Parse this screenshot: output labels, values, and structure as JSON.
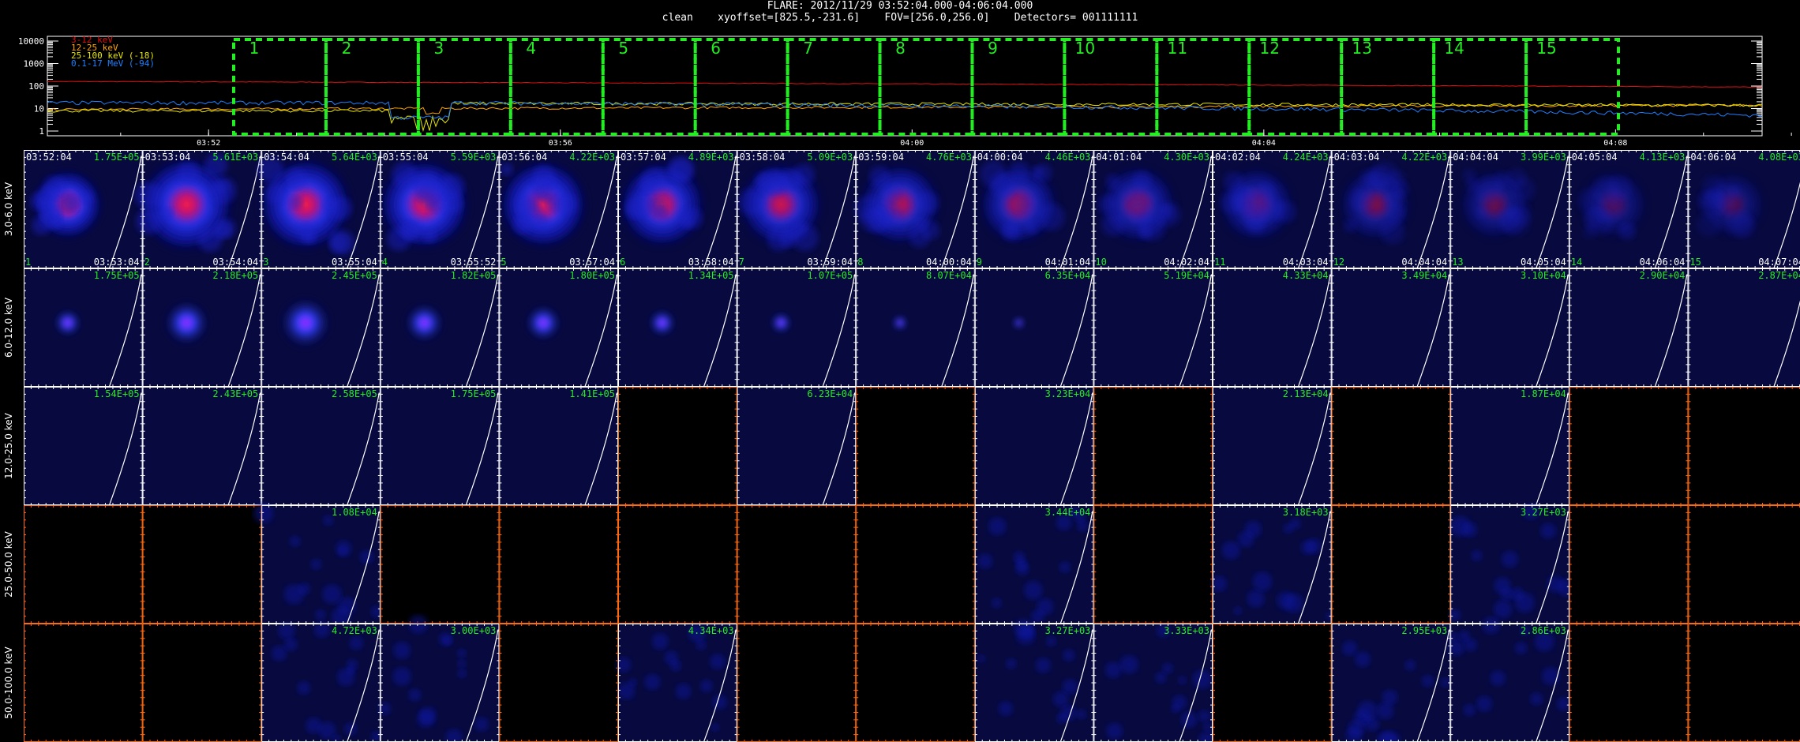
{
  "header": {
    "title": "FLARE: 2012/11/29 03:52:04.000-04:06:04.000",
    "subtitle": "clean    xyoffset=[825.5,-231.6]    FOV=[256.0,256.0]    Detectors= 001111111"
  },
  "lightcurve": {
    "legend": [
      {
        "label": "3-12 keV",
        "color": "#e01010"
      },
      {
        "label": "12-25 keV",
        "color": "#ffa500"
      },
      {
        "label": "25-100 keV (-18)",
        "color": "#e6e600"
      },
      {
        "label": "0.1-17 MeV (-94)",
        "color": "#1f7fff"
      }
    ],
    "yticks": [
      "10000",
      "1000",
      "100",
      "10",
      "1"
    ],
    "xticks": [
      "03:52",
      "03:56",
      "04:00",
      "04:04",
      "04:08"
    ],
    "interval_labels": [
      "1",
      "2",
      "3",
      "4",
      "5",
      "6",
      "7",
      "8",
      "9",
      "10",
      "11",
      "12",
      "13",
      "14",
      "15"
    ],
    "interval_color": "#22ee22"
  },
  "grid": {
    "energy_bands": [
      "3.0-6.0 keV",
      "6.0-12.0 keV",
      "12.0-25.0 keV",
      "25.0-50.0 keV",
      "50.0-100.0 keV"
    ],
    "start_times": [
      "03:52:04",
      "03:53:04",
      "03:54:04",
      "03:55:04",
      "03:56:04",
      "03:57:04",
      "03:58:04",
      "03:59:04",
      "04:00:04",
      "04:01:04",
      "04:02:04",
      "04:03:04",
      "04:04:04",
      "04:05:04",
      "04:06:04"
    ],
    "end_times": [
      "03:53:04",
      "03:54:04",
      "03:55:04",
      "03:55:52",
      "03:57:04",
      "03:58:04",
      "03:59:04",
      "04:00:04",
      "04:01:04",
      "04:02:04",
      "04:03:04",
      "04:04:04",
      "04:05:04",
      "04:06:04",
      "04:07:04"
    ],
    "cell_numbers": [
      "1",
      "2",
      "3",
      "4",
      "5",
      "6",
      "7",
      "8",
      "9",
      "10",
      "11",
      "12",
      "13",
      "14",
      "15"
    ],
    "peak_values": [
      [
        "1.75E+05",
        "5.61E+03",
        "5.64E+03",
        "5.59E+03",
        "4.22E+03",
        "4.89E+03",
        "5.09E+03",
        "4.76E+03",
        "4.46E+03",
        "4.30E+03",
        "4.24E+03",
        "4.22E+03",
        "3.99E+03",
        "4.13E+03",
        "4.08E+03"
      ],
      [
        "1.75E+05",
        "2.18E+05",
        "2.45E+05",
        "1.82E+05",
        "1.80E+05",
        "1.34E+05",
        "1.07E+05",
        "8.07E+04",
        "6.35E+04",
        "5.19E+04",
        "4.33E+04",
        "3.49E+04",
        "3.10E+04",
        "2.90E+04",
        "2.87E+04"
      ],
      [
        "1.54E+05",
        "2.43E+05",
        "2.58E+05",
        "1.75E+05",
        "1.41E+05",
        "",
        "6.23E+04",
        "",
        "3.23E+04",
        "",
        "2.13E+04",
        "",
        "1.87E+04",
        "",
        ""
      ],
      [
        "",
        "",
        "1.08E+04",
        "",
        "",
        "",
        "",
        "",
        "3.44E+04",
        "",
        "3.18E+03",
        "",
        "3.27E+03",
        "",
        ""
      ],
      [
        "",
        "",
        "4.72E+03",
        "3.00E+03",
        "",
        "4.34E+03",
        "",
        "",
        "3.27E+03",
        "3.33E+03",
        "",
        "2.95E+03",
        "2.86E+03",
        "",
        ""
      ]
    ],
    "label_color": "#22ee22"
  }
}
